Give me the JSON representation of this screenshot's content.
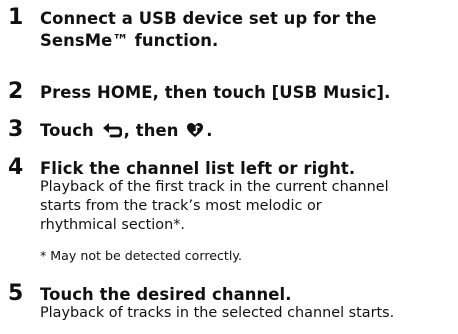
{
  "steps": [
    {
      "number": "1",
      "title_lines": [
        "Connect a USB device set up for the",
        "SensMe™ function."
      ]
    },
    {
      "number": "2",
      "title": "Press HOME, then touch [USB Music]."
    },
    {
      "number": "3",
      "title_before": "Touch",
      "icon1": "back-arrow-icon",
      "title_middle": ", then",
      "icon2": "heart-music-note-icon",
      "title_after": "."
    },
    {
      "number": "4",
      "title": "Flick the channel list left or right.",
      "body_lines": [
        "Playback of the first track in the current channel",
        "starts from the track’s most melodic or",
        "rhythmical section*."
      ],
      "note": "* May not be detected correctly."
    },
    {
      "number": "5",
      "title": "Touch the desired channel.",
      "body": "Playback of tracks in the selected channel starts."
    }
  ]
}
